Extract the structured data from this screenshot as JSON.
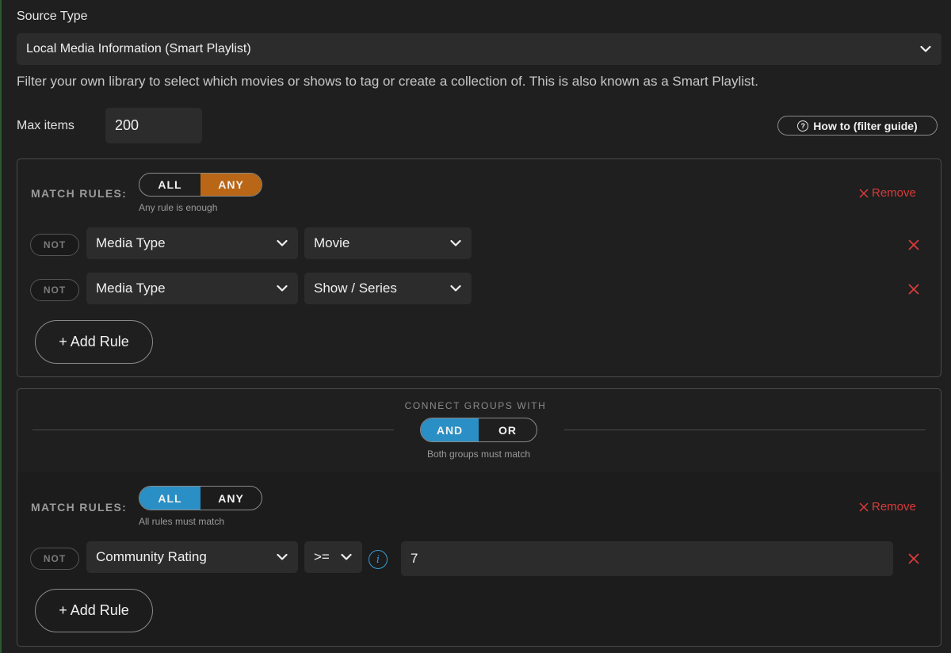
{
  "source": {
    "label": "Source Type",
    "selected": "Local Media Information (Smart Playlist)",
    "description": "Filter your own library to select which movies or shows to tag or create a collection of. This is also known as a Smart Playlist."
  },
  "max_items": {
    "label": "Max items",
    "value": "200"
  },
  "help_button": {
    "label": "How to (filter guide)",
    "icon": "question-circle-icon"
  },
  "group1": {
    "match_label": "MATCH RULES:",
    "options": [
      "ALL",
      "ANY"
    ],
    "selected": "ANY",
    "hint": "Any rule is enough",
    "remove_label": "Remove",
    "rules": [
      {
        "not_label": "NOT",
        "field": "Media Type",
        "value": "Movie"
      },
      {
        "not_label": "NOT",
        "field": "Media Type",
        "value": "Show / Series"
      }
    ],
    "add_rule_label": "+ Add Rule"
  },
  "connector": {
    "title": "CONNECT GROUPS WITH",
    "options": [
      "AND",
      "OR"
    ],
    "selected": "AND",
    "hint": "Both groups must match"
  },
  "group2": {
    "match_label": "MATCH RULES:",
    "options": [
      "ALL",
      "ANY"
    ],
    "selected": "ALL",
    "hint": "All rules must match",
    "remove_label": "Remove",
    "rules": [
      {
        "not_label": "NOT",
        "field": "Community Rating",
        "operator": ">=",
        "value": "7"
      }
    ],
    "add_rule_label": "+ Add Rule"
  },
  "colors": {
    "background": "#1f1f1f",
    "accent_orange": "#b96716",
    "accent_blue": "#2a8fc4",
    "danger": "#d93b3b"
  }
}
